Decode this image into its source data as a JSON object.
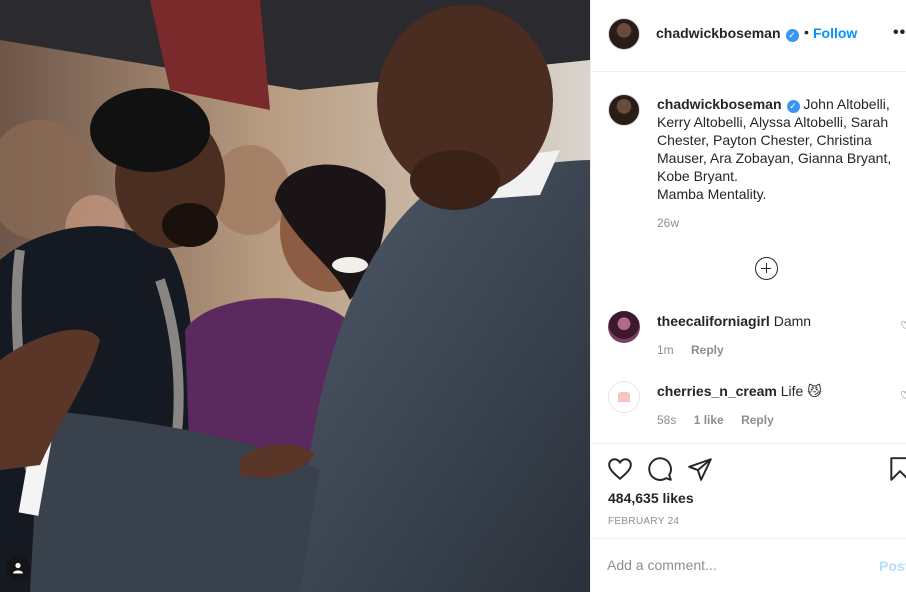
{
  "post": {
    "username": "chadwickboseman",
    "follow_label": "Follow",
    "separator": "•",
    "more_label": "•••",
    "caption": "John Altobelli, Kerry Altobelli, Alyssa Altobelli, Sarah Chester, Payton Chester, Christina Mauser, Ara Zobayan, Gianna Bryant, Kobe Bryant.",
    "caption_line2": "Mamba Mentality.",
    "caption_time": "26w",
    "likes": "484,635 likes",
    "date": "FEBRUARY 24"
  },
  "comments": [
    {
      "username": "theecaliforniagirl",
      "text": "Damn",
      "time": "1m",
      "likes": "",
      "reply_label": "Reply"
    },
    {
      "username": "cherries_n_cream",
      "text": "Life 😼",
      "time": "58s",
      "likes": "1 like",
      "reply_label": "Reply"
    }
  ],
  "add_comment": {
    "placeholder": "Add a comment...",
    "post_label": "Post"
  },
  "icons": {
    "verified": "verified-badge-icon",
    "like": "heart-icon",
    "comment": "comment-bubble-icon",
    "share": "paper-plane-icon",
    "save": "bookmark-icon",
    "load_more": "plus-circle-icon",
    "user_tag": "user-tag-icon"
  },
  "colors": {
    "accent": "#0095f6",
    "verified": "#3897f0",
    "muted": "#8e8e8e",
    "text": "#262626"
  }
}
